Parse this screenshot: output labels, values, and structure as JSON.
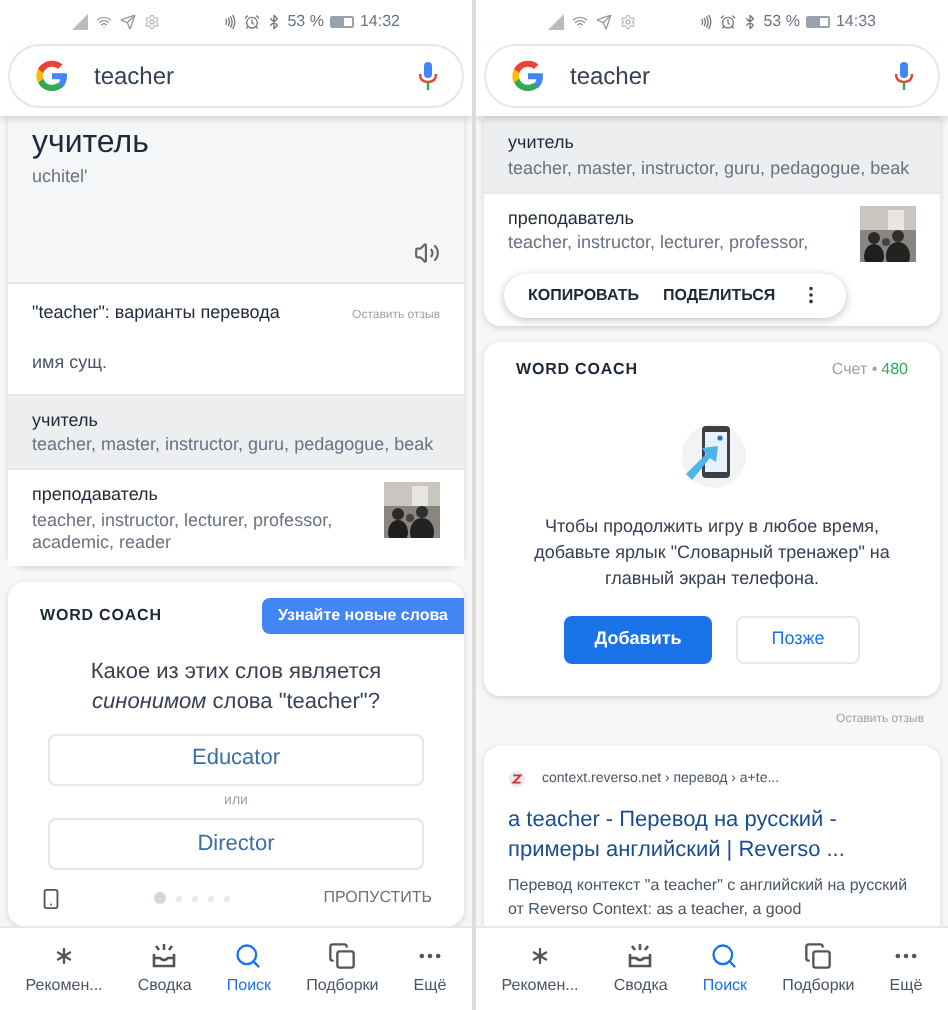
{
  "screens": [
    {
      "status_bar": {
        "battery": "53 %",
        "time": "14:32"
      },
      "search": {
        "value": "teacher"
      },
      "translation": {
        "word": "учитель",
        "transliteration": "uchitel'",
        "variants_title": "\"teacher\": варианты перевода",
        "feedback": "Оставить отзыв",
        "part_of_speech": "имя сущ.",
        "rows": [
          {
            "word": "учитель",
            "synonyms": "teacher, master, instructor, guru, pedagogue, beak",
            "selected": true
          },
          {
            "word": "преподаватель",
            "synonyms": "teacher, instructor, lecturer, professor, academic, reader",
            "selected": false,
            "kind": "picture"
          }
        ]
      },
      "word_coach": {
        "kind": "quiz",
        "title": "WORD COACH",
        "badge": "Узнайте новые слова",
        "question": "Какое из этих слов является *синонимом* слова \"teacher\"?",
        "options": [
          "Educator",
          "Director"
        ],
        "separator": "или",
        "dots": [
          {
            "selected": true
          },
          {
            "selected": false
          },
          {
            "selected": false
          },
          {
            "selected": false
          },
          {
            "selected": false
          }
        ],
        "skip": "ПРОПУСТИТЬ"
      },
      "nav": [
        {
          "label": "Рекомен...",
          "selected": false
        },
        {
          "label": "Сводка",
          "selected": false
        },
        {
          "label": "Поиск",
          "selected": true
        },
        {
          "label": "Подборки",
          "selected": false
        },
        {
          "label": "Ещё",
          "selected": false
        }
      ]
    },
    {
      "status_bar": {
        "battery": "53 %",
        "time": "14:33"
      },
      "search": {
        "value": "teacher"
      },
      "translation": {
        "rows": [
          {
            "word": "учитель",
            "synonyms": "teacher, master, instructor, guru, pedagogue, beak",
            "selected": true
          },
          {
            "word": "преподаватель",
            "synonyms": "teacher, instructor, lecturer, professor,",
            "selected": false,
            "kind": "picture"
          }
        ]
      },
      "popup": {
        "actions": [
          "КОПИРОВАТЬ",
          "ПОДЕЛИТЬСЯ"
        ]
      },
      "word_coach": {
        "kind": "shortcut",
        "title": "WORD COACH",
        "score_label": "Счет •",
        "score": "480",
        "message": "Чтобы продолжить игру в любое время, добавьте ярлык \"Словарный тренажер\" на главный экран телефона.",
        "primary": "Добавить",
        "secondary": "Позже"
      },
      "feedback": "Оставить отзыв",
      "result": {
        "url": "context.reverso.net › перевод › a+te...",
        "title": "a teacher - Перевод на русский - примеры английский | Reverso ...",
        "snippet": "Перевод контекст \"a teacher\" с английский на русский от Reverso Context: as a teacher, a good"
      },
      "nav": [
        {
          "label": "Рекомен...",
          "selected": false
        },
        {
          "label": "Сводка",
          "selected": false
        },
        {
          "label": "Поиск",
          "selected": true
        },
        {
          "label": "Подборки",
          "selected": false
        },
        {
          "label": "Ещё",
          "selected": false
        }
      ]
    }
  ]
}
